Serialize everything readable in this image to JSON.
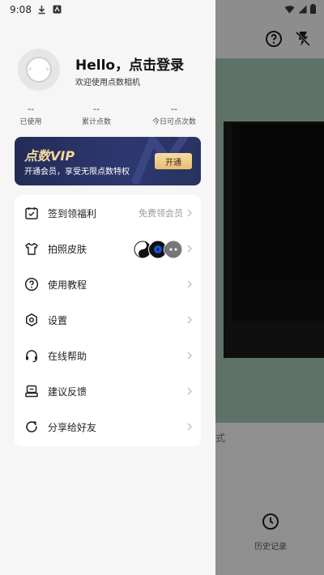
{
  "status_bar": {
    "time": "9:08"
  },
  "profile": {
    "greeting": "Hello，点击登录",
    "subtitle": "欢迎使用点数相机"
  },
  "stats": [
    {
      "value": "--",
      "label": "已使用"
    },
    {
      "value": "--",
      "label": "累计点数"
    },
    {
      "value": "--",
      "label": "今日可点次数"
    }
  ],
  "vip": {
    "title": "点数VIP",
    "subtitle": "开通会员，享受无限点数特权",
    "button": "开通"
  },
  "menu": [
    {
      "label": "签到领福利",
      "hint": "免费领会员",
      "icon": "calendar-check-icon"
    },
    {
      "label": "拍照皮肤",
      "icon": "tshirt-icon"
    },
    {
      "label": "使用教程",
      "icon": "help-circle-icon"
    },
    {
      "label": "设置",
      "icon": "settings-hex-icon"
    },
    {
      "label": "在线帮助",
      "icon": "headset-icon"
    },
    {
      "label": "建议反馈",
      "icon": "feedback-box-icon"
    },
    {
      "label": "分享给好友",
      "icon": "share-refresh-icon"
    }
  ],
  "background": {
    "history_label": "历史记录",
    "stray_char": "式"
  },
  "colors": {
    "vip_gold": "#f3d69d",
    "vip_bg": "#2d3870",
    "drawer_bg": "#f6f6f6",
    "camera_green": "#5f7268"
  }
}
